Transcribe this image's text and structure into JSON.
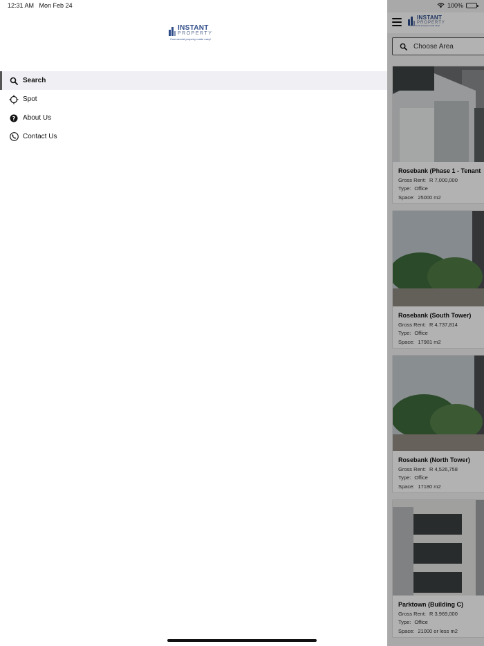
{
  "status_bar": {
    "time": "12:31 AM",
    "date": "Mon Feb 24",
    "battery_text": "100%"
  },
  "logo": {
    "name": "INSTANT",
    "sub": "PROPERTY",
    "tagline": "Commercial property made easy!"
  },
  "menu": {
    "items": [
      {
        "label": "Search",
        "icon": "search-icon",
        "active": true
      },
      {
        "label": "Spot",
        "icon": "crosshair-icon",
        "active": false
      },
      {
        "label": "About Us",
        "icon": "help-circle-icon",
        "active": false
      },
      {
        "label": "Contact Us",
        "icon": "phone-icon",
        "active": false
      }
    ]
  },
  "main": {
    "search_placeholder": "Choose Area",
    "labels": {
      "gross_rent": "Gross Rent:",
      "type": "Type:",
      "space": "Space:"
    },
    "listings": [
      {
        "title": "Rosebank (Phase 1 - Tenant",
        "gross_rent": "R 7,000,000",
        "type": "Office",
        "space": "25000 m2"
      },
      {
        "title": "Rosebank (South Tower)",
        "gross_rent": "R 4,737,814",
        "type": "Office",
        "space": "17981 m2"
      },
      {
        "title": "Rosebank (North Tower)",
        "gross_rent": "R 4,526,758",
        "type": "Office",
        "space": "17180 m2"
      },
      {
        "title": "Parktown (Building C)",
        "gross_rent": "R 3,969,000",
        "type": "Office",
        "space": "21000 or less m2"
      }
    ]
  },
  "colors": {
    "brand": "#2e4c89",
    "active_bg": "#efeff4",
    "overlay": "rgba(0,0,0,0.3)"
  }
}
